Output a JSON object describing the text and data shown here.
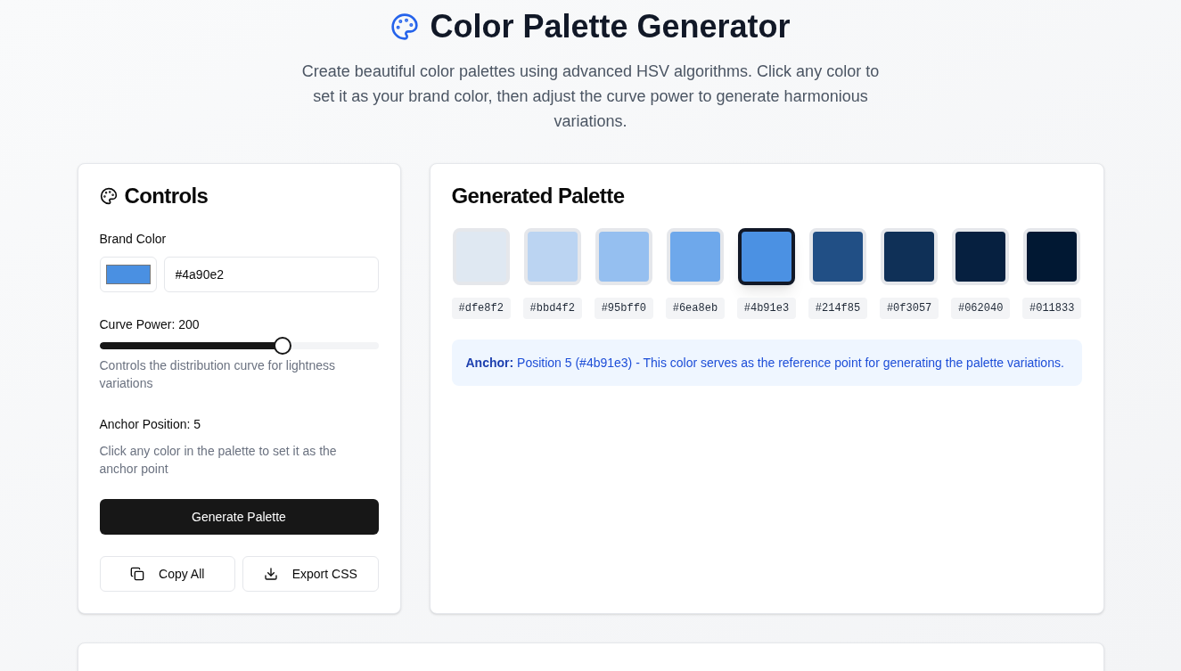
{
  "header": {
    "title": "Color Palette Generator",
    "subtitle": "Create beautiful color palettes using advanced HSV algorithms. Click any color to set it as your brand color, then adjust the curve power to generate harmonious variations."
  },
  "controls": {
    "title": "Controls",
    "brand_color": {
      "label": "Brand Color",
      "color": "#4a90e2",
      "value": "#4a90e2"
    },
    "curve_power": {
      "label": "Curve Power: 200",
      "level": 0.667,
      "hint": "Controls the distribution curve for lightness variations"
    },
    "anchor_position": {
      "label": "Anchor Position: 5",
      "hint": "Click any color in the palette to set it as the anchor point"
    },
    "primary_button": {
      "label": "Generate Palette"
    },
    "buttons": [
      {
        "kind": "copy",
        "label": "Copy All"
      },
      {
        "kind": "export",
        "label": "Export CSS"
      }
    ]
  },
  "palette": {
    "title": "Generated Palette",
    "swatches": [
      {
        "color": "#dfe8f2",
        "hex": "#dfe8f2",
        "selected": false
      },
      {
        "color": "#bbd4f2",
        "hex": "#bbd4f2",
        "selected": false
      },
      {
        "color": "#95bff0",
        "hex": "#95bff0",
        "selected": false
      },
      {
        "color": "#6ea8eb",
        "hex": "#6ea8eb",
        "selected": false
      },
      {
        "color": "#4b91e3",
        "hex": "#4b91e3",
        "selected": true
      },
      {
        "color": "#214f85",
        "hex": "#214f85",
        "selected": false
      },
      {
        "color": "#0f3057",
        "hex": "#0f3057",
        "selected": false
      },
      {
        "color": "#062040",
        "hex": "#062040",
        "selected": false
      },
      {
        "color": "#011833",
        "hex": "#011833",
        "selected": false
      }
    ],
    "note": "**Anchor:** Position 5 (#4b91e3) - This color serves as the reference point for generating the palette variations."
  }
}
